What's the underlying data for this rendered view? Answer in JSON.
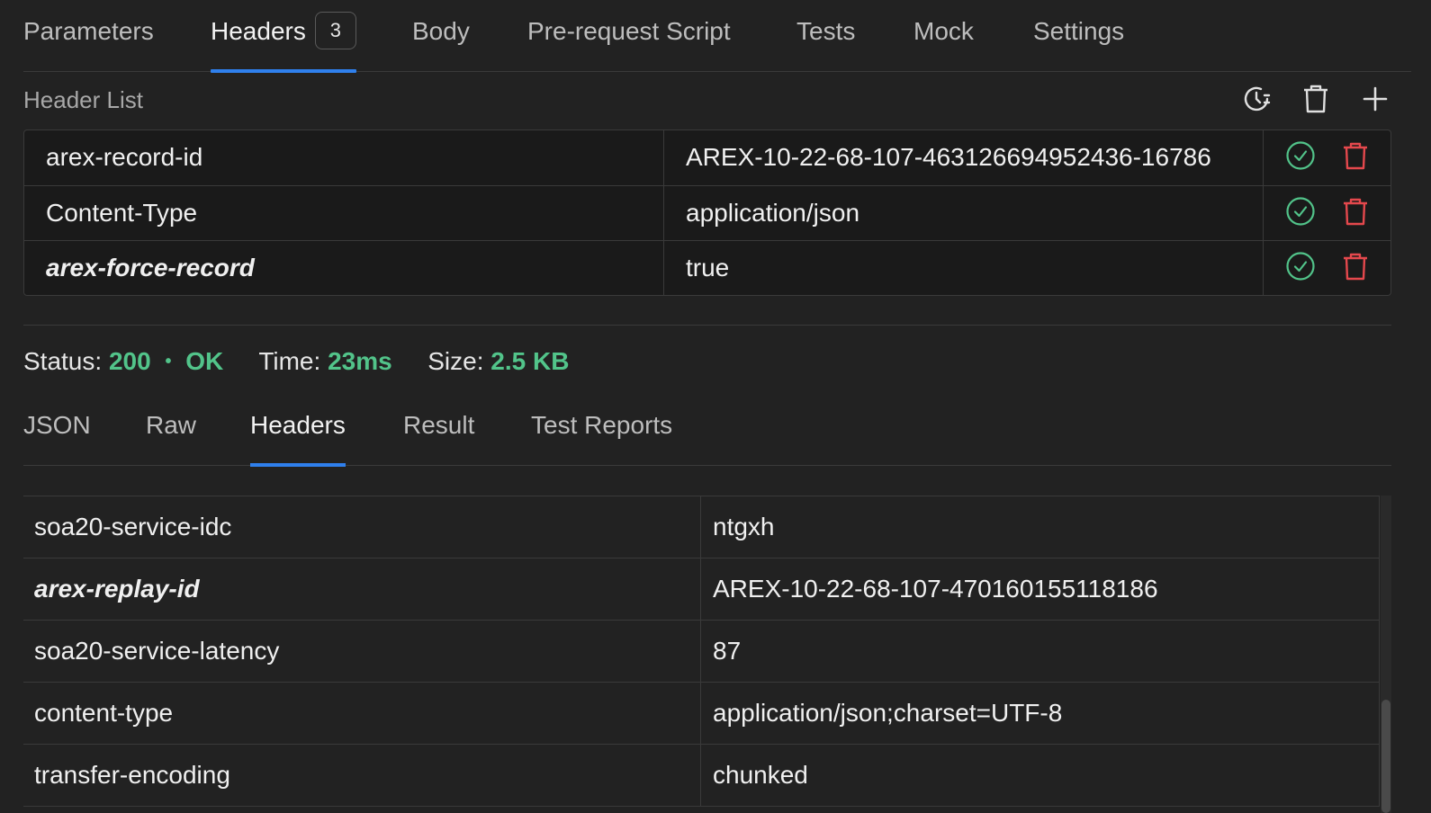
{
  "request_tabs": [
    {
      "label": "Parameters"
    },
    {
      "label": "Headers",
      "badge": "3"
    },
    {
      "label": "Body"
    },
    {
      "label": "Pre-request Script"
    },
    {
      "label": "Tests"
    },
    {
      "label": "Mock"
    },
    {
      "label": "Settings"
    }
  ],
  "active_request_tab": "Headers",
  "header_list": {
    "title": "Header List",
    "actions": [
      "history-icon",
      "trash-icon",
      "plus-icon"
    ],
    "rows": [
      {
        "key": "arex-record-id",
        "value": "AREX-10-22-68-107-463126694952436-16786",
        "enabled": true
      },
      {
        "key": "Content-Type",
        "value": "application/json",
        "enabled": true
      },
      {
        "key": "arex-force-record",
        "value": "true",
        "enabled": true
      }
    ]
  },
  "status": {
    "status_label": "Status:",
    "code": "200",
    "dot": "•",
    "text": "OK",
    "time_label": "Time:",
    "time": "23ms",
    "size_label": "Size:",
    "size": "2.5 KB"
  },
  "response_tabs": [
    {
      "label": "JSON"
    },
    {
      "label": "Raw"
    },
    {
      "label": "Headers"
    },
    {
      "label": "Result"
    },
    {
      "label": "Test Reports"
    }
  ],
  "active_response_tab": "Headers",
  "response_headers": [
    {
      "key": "soa20-service-idc",
      "value": "ntgxh"
    },
    {
      "key": "arex-replay-id",
      "value": "AREX-10-22-68-107-470160155118186"
    },
    {
      "key": "soa20-service-latency",
      "value": "87"
    },
    {
      "key": "content-type",
      "value": "application/json;charset=UTF-8"
    },
    {
      "key": "transfer-encoding",
      "value": "chunked"
    }
  ],
  "colors": {
    "accent": "#2f80ed",
    "success": "#52c48a",
    "danger": "#e5484d",
    "background": "#222222"
  }
}
